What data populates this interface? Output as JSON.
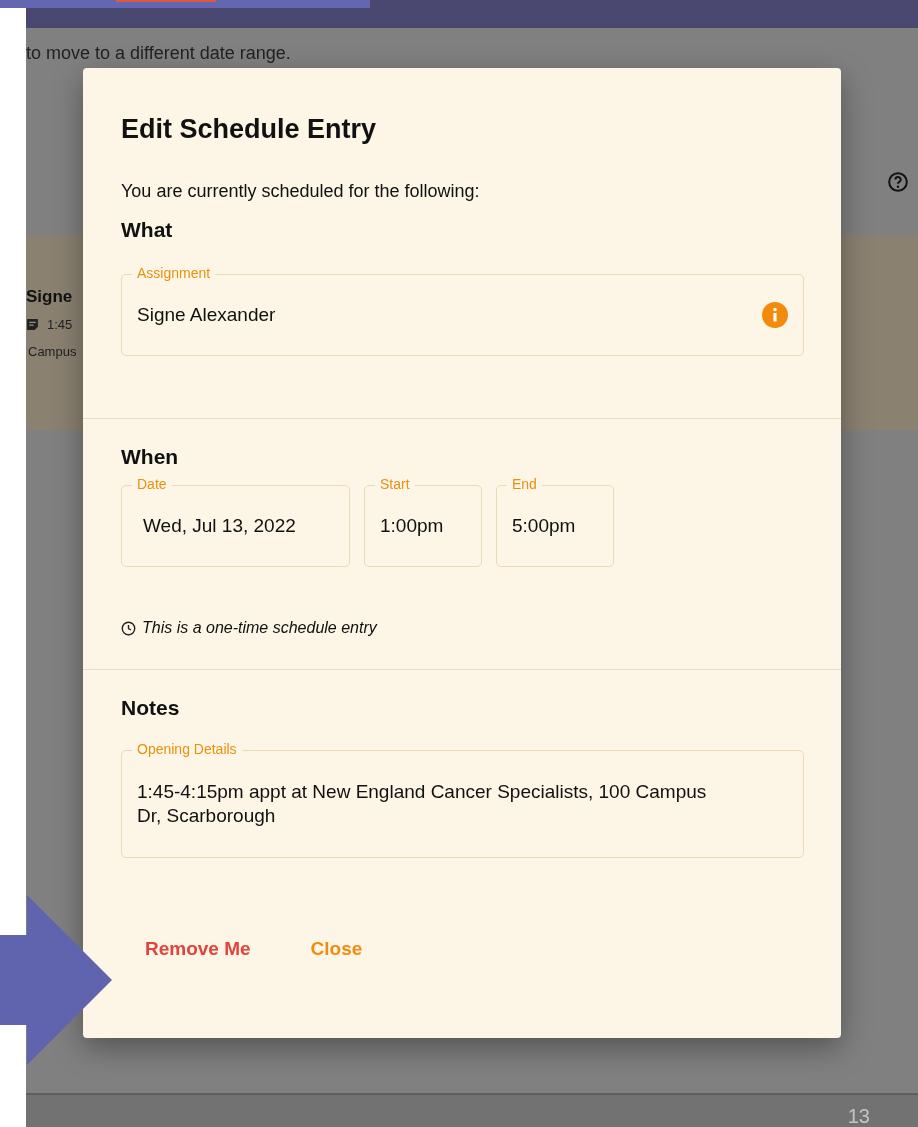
{
  "background": {
    "instruction": "to move to a different date range.",
    "entry": {
      "title": "Signe",
      "time": "1:45",
      "location": "Campus"
    },
    "page_number": "13"
  },
  "dialog": {
    "title": "Edit Schedule Entry",
    "intro": "You are currently scheduled for the following:",
    "what": {
      "heading": "What",
      "field": {
        "label": "Assignment",
        "value": "Signe Alexander"
      }
    },
    "when": {
      "heading": "When",
      "fields": [
        {
          "label": "Date",
          "value": "Wed, Jul 13, 2022"
        },
        {
          "label": "Start",
          "value": "1:00pm"
        },
        {
          "label": "End",
          "value": "5:00pm"
        }
      ],
      "note": "This is a one-time schedule entry"
    },
    "notes": {
      "heading": "Notes",
      "field": {
        "label": "Opening Details",
        "value": "1:45-4:15pm appt at New England Cancer Specialists, 100 Campus Dr, Scarborough"
      }
    },
    "actions": [
      {
        "label": "Remove Me",
        "kind": "danger"
      },
      {
        "label": "Close",
        "kind": "primary"
      }
    ]
  }
}
